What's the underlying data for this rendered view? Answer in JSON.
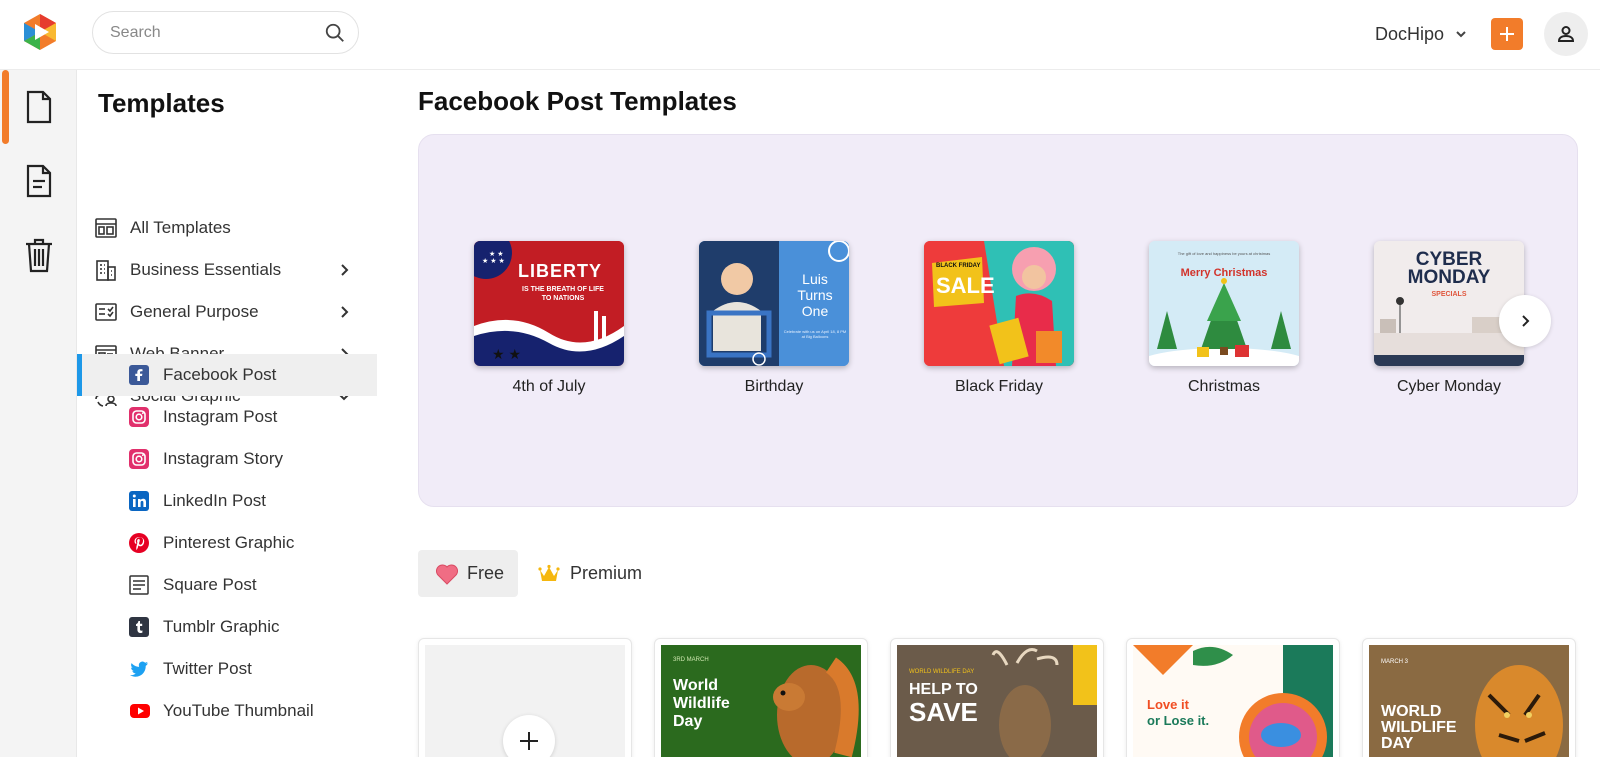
{
  "header": {
    "search_placeholder": "Search",
    "account_label": "DocHipo",
    "accent_color": "#f27c2a"
  },
  "rail": {
    "items": [
      {
        "icon": "document-icon",
        "active": true
      },
      {
        "icon": "file-list-icon",
        "active": false
      },
      {
        "icon": "trash-icon",
        "active": false
      }
    ]
  },
  "sidebar": {
    "title": "Templates",
    "items": [
      {
        "label": "All Templates",
        "icon": "grid-layout-icon",
        "chevron": "none"
      },
      {
        "label": "Business Essentials",
        "icon": "building-icon",
        "chevron": "right"
      },
      {
        "label": "General Purpose",
        "icon": "checklist-icon",
        "chevron": "right"
      },
      {
        "label": "Web Banner",
        "icon": "banner-icon",
        "chevron": "right"
      },
      {
        "label": "Social Graphic",
        "icon": "share-people-icon",
        "chevron": "down"
      }
    ],
    "sub_items": [
      {
        "label": "Facebook Post",
        "icon": "facebook-icon",
        "active": true
      },
      {
        "label": "Instagram Post",
        "icon": "instagram-icon"
      },
      {
        "label": "Instagram Story",
        "icon": "instagram-icon"
      },
      {
        "label": "LinkedIn Post",
        "icon": "linkedin-icon"
      },
      {
        "label": "Pinterest Graphic",
        "icon": "pinterest-icon"
      },
      {
        "label": "Square Post",
        "icon": "square-post-icon"
      },
      {
        "label": "Tumblr Graphic",
        "icon": "tumblr-icon"
      },
      {
        "label": "Twitter Post",
        "icon": "twitter-icon"
      },
      {
        "label": "YouTube Thumbnail",
        "icon": "youtube-icon"
      }
    ]
  },
  "main": {
    "title": "Facebook Post Templates",
    "categories": [
      {
        "label": "4th of July",
        "thumb_title": "LIBERTY",
        "thumb_sub": "IS THE BREATH OF LIFE TO NATIONS"
      },
      {
        "label": "Birthday",
        "thumb_title": "Luis Turns One",
        "thumb_sub": "Celebrate with us on April 18, 8 PM at Big Balloons"
      },
      {
        "label": "Black Friday",
        "thumb_title": "SALE",
        "thumb_sub": "BLACK FRIDAY"
      },
      {
        "label": "Christmas",
        "thumb_title": "Merry Christmas",
        "thumb_sub": "The gift of love and happiness be yours at christmas"
      },
      {
        "label": "Cyber Monday",
        "thumb_title": "CYBER MONDAY",
        "thumb_sub": "SPECIALS"
      }
    ],
    "filters": {
      "free": "Free",
      "premium": "Premium"
    },
    "templates": [
      {
        "type": "create"
      },
      {
        "line1": "World",
        "line2": "Wildlife",
        "line3": "Day",
        "tag": "3RD MARCH"
      },
      {
        "line1": "HELP TO",
        "line2": "SAVE",
        "tag": "WORLD WILDLIFE DAY"
      },
      {
        "line1": "Love it",
        "line2": "or Lose it."
      },
      {
        "line1": "WORLD",
        "line2": "WILDLIFE",
        "line3": "DAY",
        "tag": "MARCH 3"
      }
    ]
  }
}
